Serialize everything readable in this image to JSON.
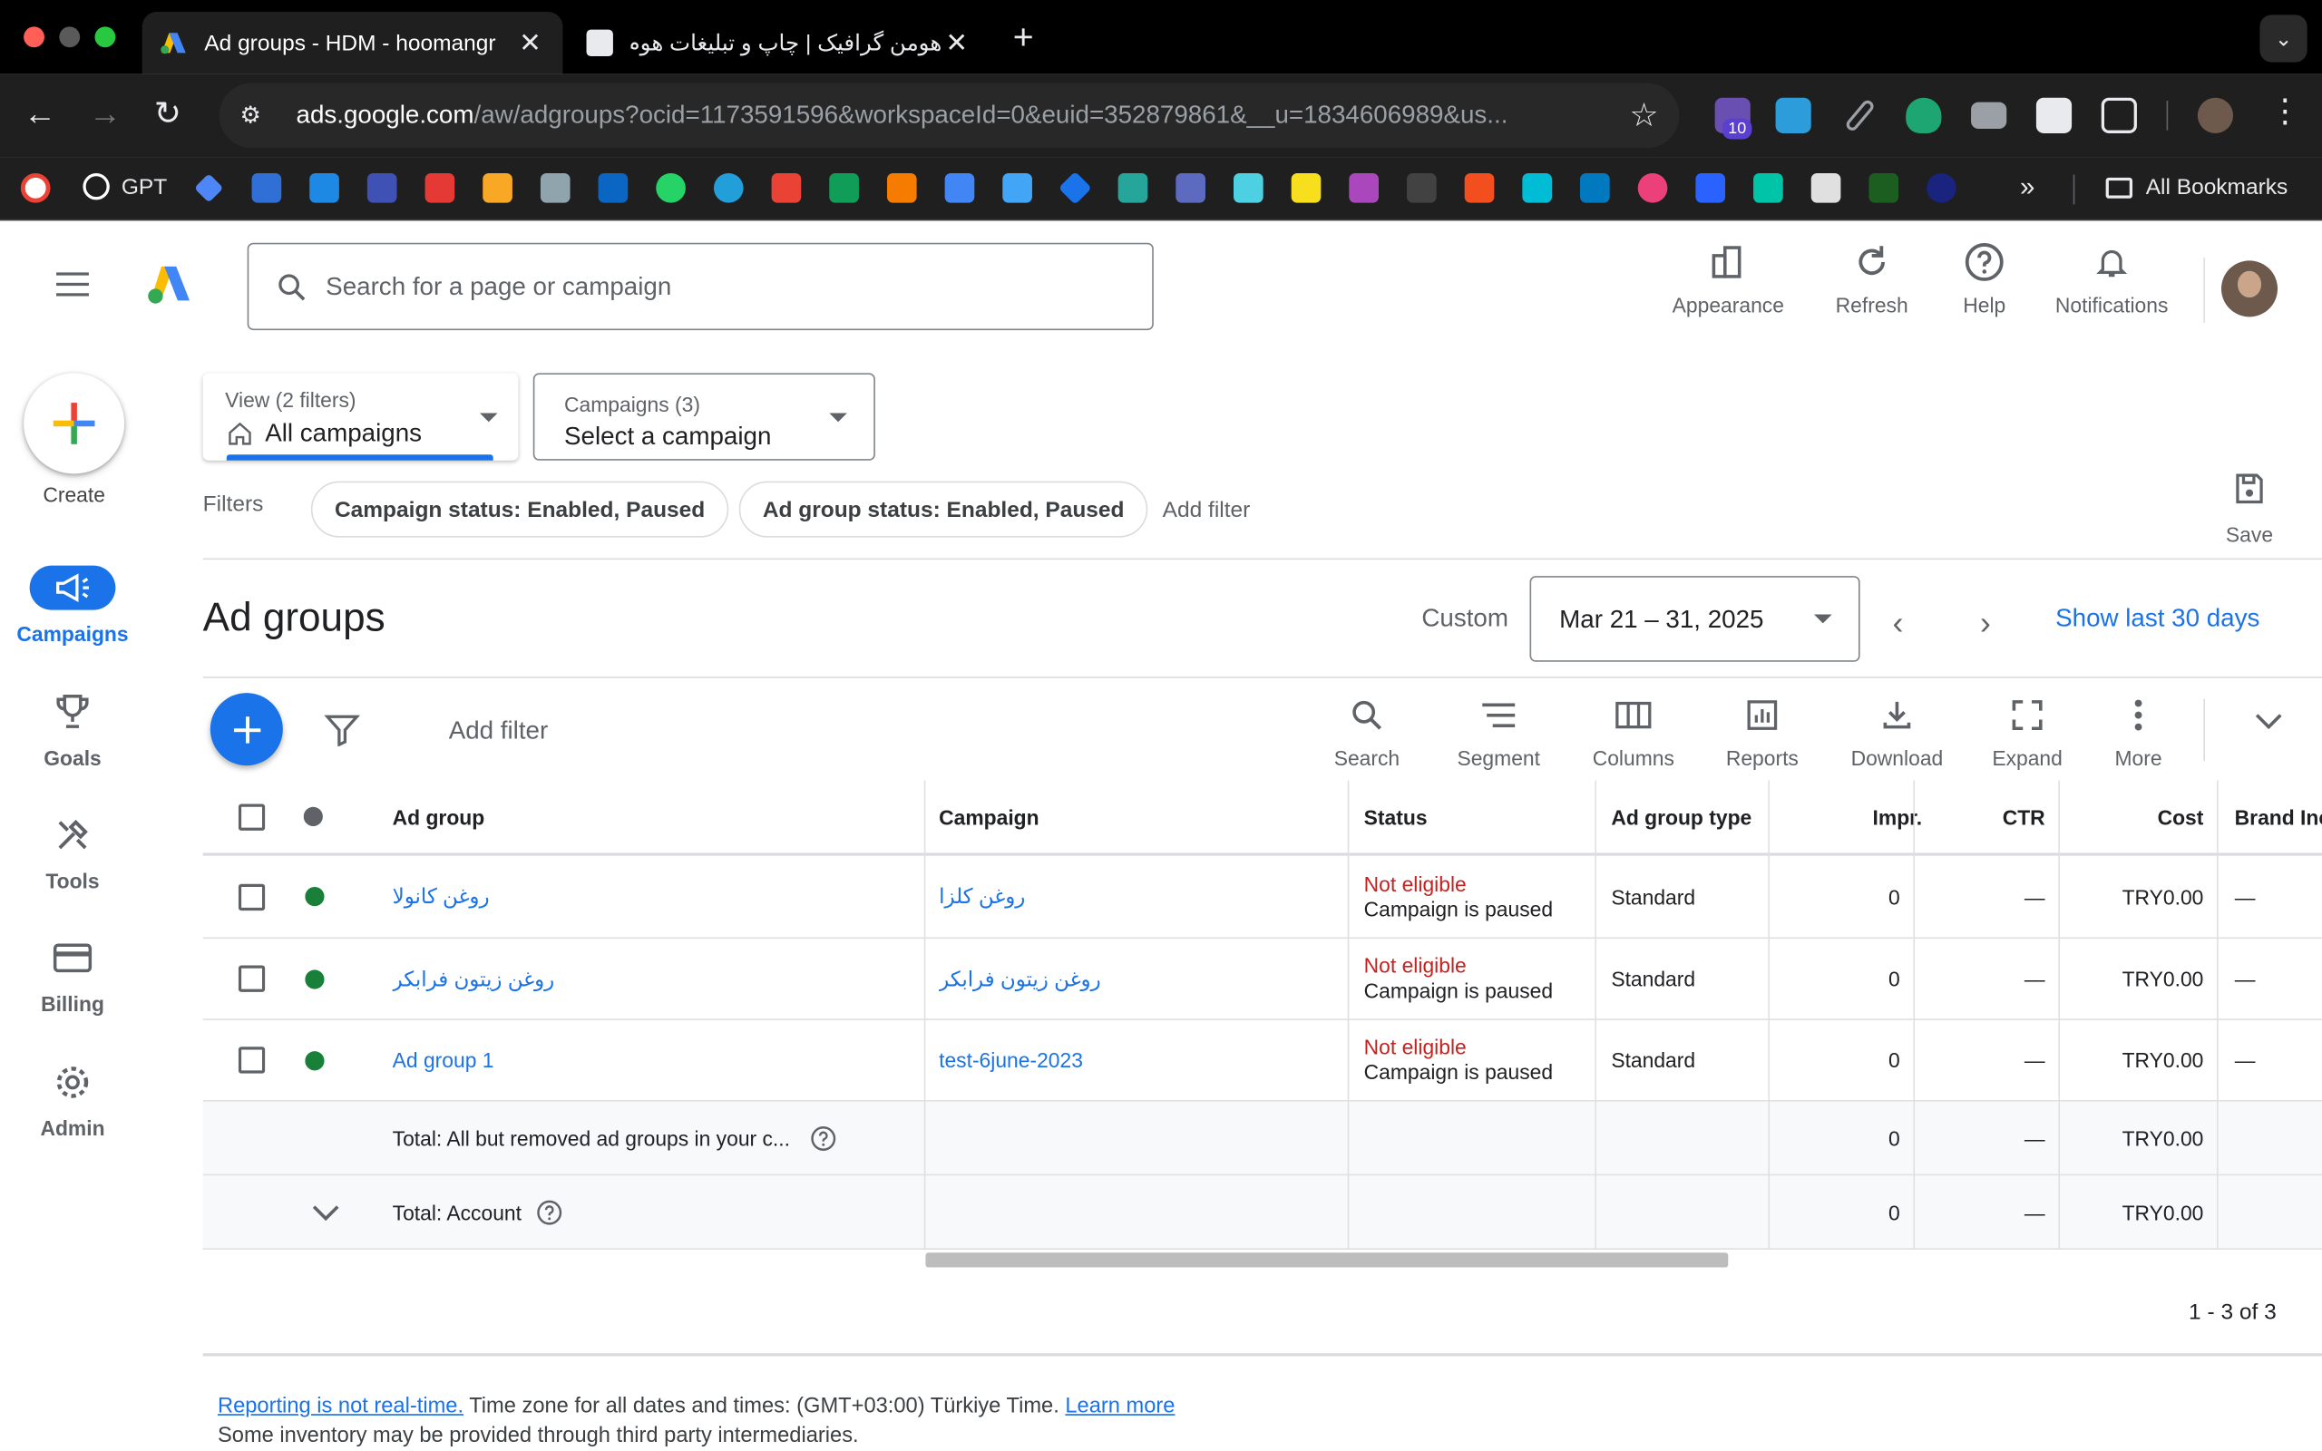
{
  "browser": {
    "tabs": [
      {
        "title": "Ad groups - HDM - hoomangr",
        "active": true
      },
      {
        "title": "هومن گرافیک | چاپ و تبلیغات هوم",
        "active": false
      }
    ],
    "url_host": "ads.google.com",
    "url_path": "/aw/adgroups?ocid=1173591596&workspaceId=0&euid=352879861&__u=1834606989&us...",
    "extension_badge": "10",
    "bookmarks": {
      "gpt_label": "GPT",
      "all_label": "All Bookmarks"
    }
  },
  "header": {
    "search_placeholder": "Search for a page or campaign",
    "buttons": {
      "appearance": "Appearance",
      "refresh": "Refresh",
      "help": "Help",
      "notifications": "Notifications"
    }
  },
  "sidenav": {
    "create": "Create",
    "items": [
      {
        "label": "Campaigns",
        "icon": "megaphone-icon",
        "active": true
      },
      {
        "label": "Goals",
        "icon": "trophy-icon"
      },
      {
        "label": "Tools",
        "icon": "tools-icon"
      },
      {
        "label": "Billing",
        "icon": "credit-card-icon"
      },
      {
        "label": "Admin",
        "icon": "gear-icon"
      }
    ]
  },
  "filters": {
    "view_small": "View (2 filters)",
    "view_big": "All campaigns",
    "campaigns_small": "Campaigns (3)",
    "campaigns_big": "Select a campaign",
    "label": "Filters",
    "chips": [
      "Campaign status: Enabled, Paused",
      "Ad group status: Enabled, Paused"
    ],
    "add_filter": "Add filter",
    "save": "Save"
  },
  "page": {
    "title": "Ad groups",
    "date_mode": "Custom",
    "date_range": "Mar 21 – 31, 2025",
    "show_last": "Show last 30 days"
  },
  "table_toolbar": {
    "add_filter": "Add filter",
    "tools": [
      "Search",
      "Segment",
      "Columns",
      "Reports",
      "Download",
      "Expand",
      "More"
    ]
  },
  "table": {
    "columns": [
      "Ad group",
      "Campaign",
      "Status",
      "Ad group type",
      "Impr.",
      "CTR",
      "Cost",
      "Brand Inc"
    ],
    "rows": [
      {
        "ad_group": "روغن کانولا",
        "campaign": "روغن کلزا",
        "status": "Not eligible",
        "status_detail": "Campaign is paused",
        "type": "Standard",
        "impr": "0",
        "ctr": "—",
        "cost": "TRY0.00",
        "brand": "—"
      },
      {
        "ad_group": "روغن زیتون فرابکر",
        "campaign": "روغن زیتون فرابکر",
        "status": "Not eligible",
        "status_detail": "Campaign is paused",
        "type": "Standard",
        "impr": "0",
        "ctr": "—",
        "cost": "TRY0.00",
        "brand": "—"
      },
      {
        "ad_group": "Ad group 1",
        "campaign": "test-6june-2023",
        "status": "Not eligible",
        "status_detail": "Campaign is paused",
        "type": "Standard",
        "impr": "0",
        "ctr": "—",
        "cost": "TRY0.00",
        "brand": "—"
      }
    ],
    "totals": [
      {
        "label": "Total: All but removed ad groups in your c...",
        "impr": "0",
        "ctr": "—",
        "cost": "TRY0.00"
      },
      {
        "label": "Total: Account",
        "impr": "0",
        "ctr": "—",
        "cost": "TRY0.00"
      }
    ],
    "pagination": "1 - 3 of 3"
  },
  "footer": {
    "link1": "Reporting is not real-time.",
    "text1": " Time zone for all dates and times: (GMT+03:00) Türkiye Time. ",
    "link2": "Learn more",
    "line2": "Some inventory may be provided through third party intermediaries."
  },
  "colors": {
    "accent": "#1a73e8",
    "status_enabled": "#188038",
    "not_eligible": "#c5221f"
  }
}
